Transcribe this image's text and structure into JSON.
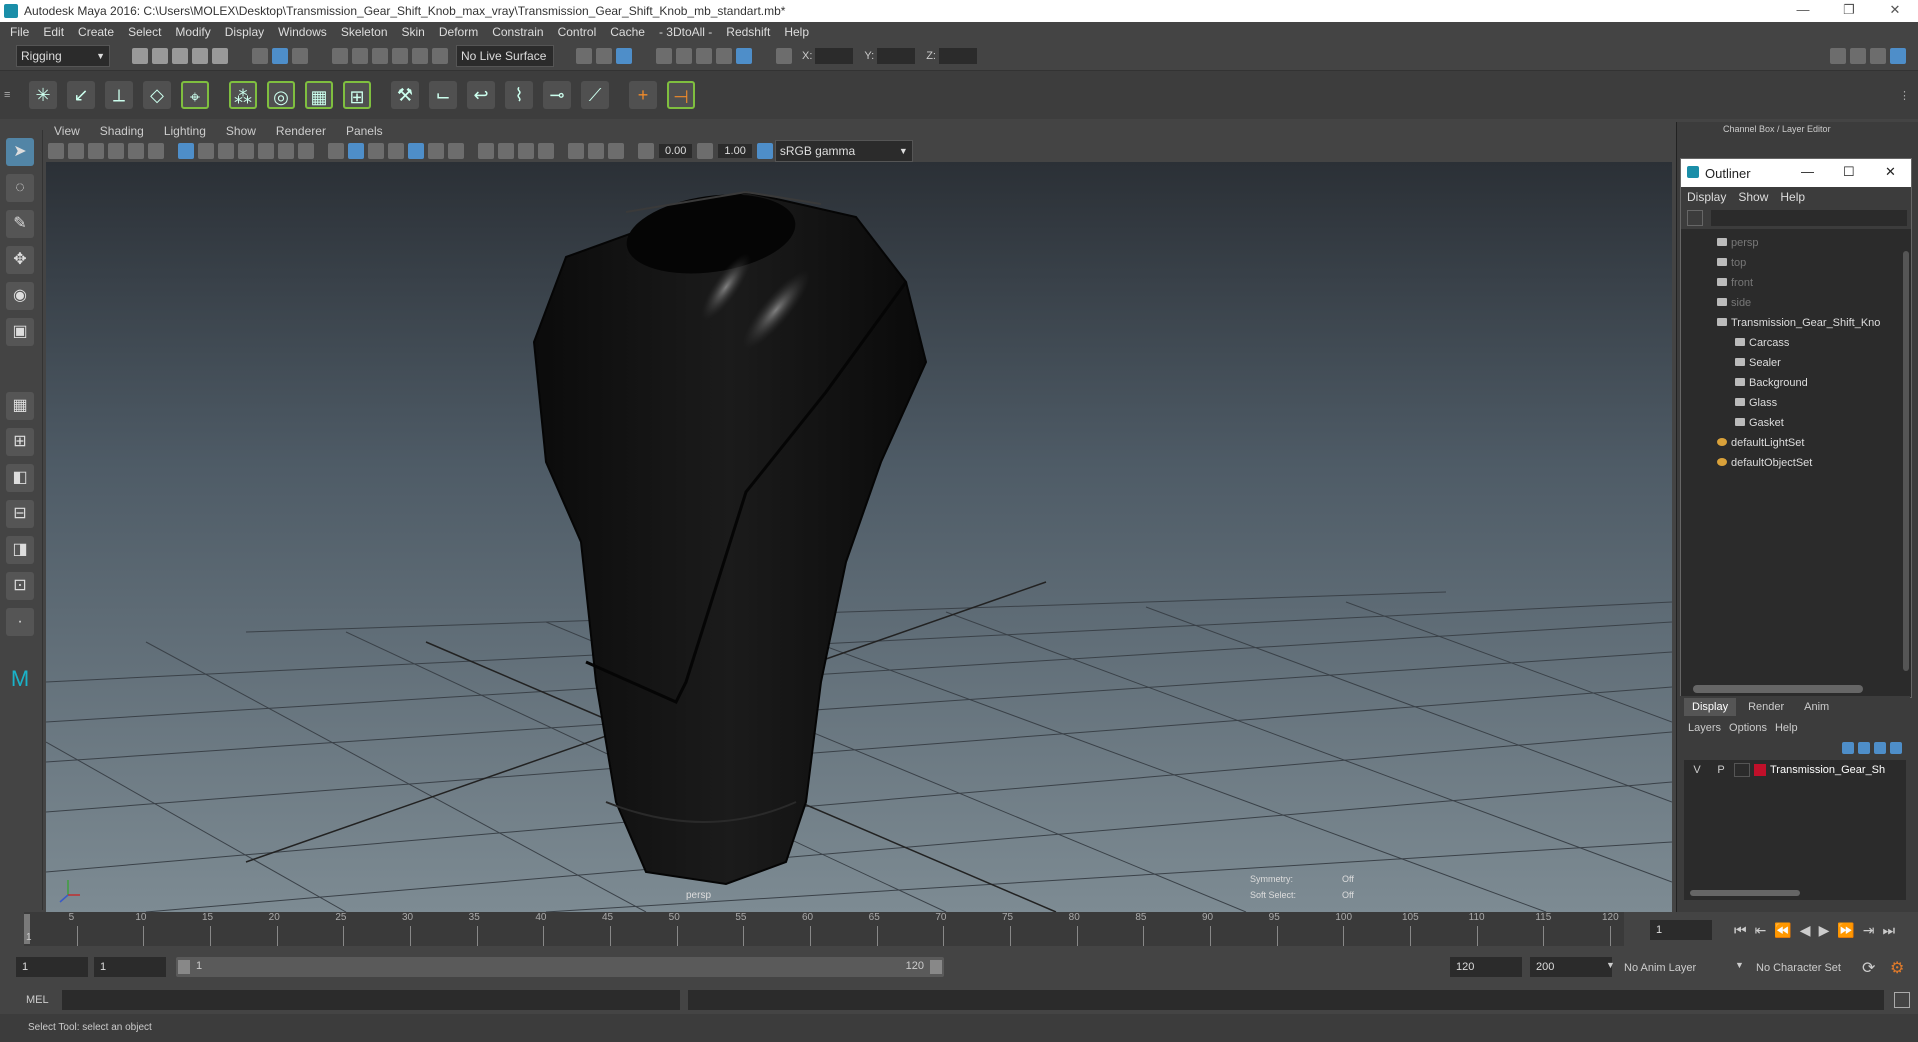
{
  "window": {
    "title": "Autodesk Maya 2016: C:\\Users\\MOLEX\\Desktop\\Transmission_Gear_Shift_Knob_max_vray\\Transmission_Gear_Shift_Knob_mb_standart.mb*"
  },
  "menubar": [
    "File",
    "Edit",
    "Create",
    "Select",
    "Modify",
    "Display",
    "Windows",
    "Skeleton",
    "Skin",
    "Deform",
    "Constrain",
    "Control",
    "Cache",
    "- 3DtoAll -",
    "Redshift",
    "Help"
  ],
  "statusline": {
    "mode": "Rigging",
    "live_surface": "No Live Surface",
    "x_label": "X:",
    "y_label": "Y:",
    "z_label": "Z:"
  },
  "panel_menu": [
    "View",
    "Shading",
    "Lighting",
    "Show",
    "Renderer",
    "Panels"
  ],
  "panel_tools": {
    "exposure": "0.00",
    "gamma": "1.00",
    "color_space": "sRGB gamma"
  },
  "viewport": {
    "camera": "persp",
    "symmetry_label": "Symmetry:",
    "symmetry_value": "Off",
    "soft_select_label": "Soft Select:",
    "soft_select_value": "Off"
  },
  "channel_box_title": "Channel Box / Layer Editor",
  "outliner": {
    "title": "Outliner",
    "menu": [
      "Display",
      "Show",
      "Help"
    ],
    "items": [
      {
        "label": "persp",
        "dim": true,
        "indent": 2
      },
      {
        "label": "top",
        "dim": true,
        "indent": 2
      },
      {
        "label": "front",
        "dim": true,
        "indent": 2
      },
      {
        "label": "side",
        "dim": true,
        "indent": 2
      },
      {
        "label": "Transmission_Gear_Shift_Kno",
        "dim": false,
        "indent": 2
      },
      {
        "label": "Carcass",
        "dim": false,
        "indent": 3
      },
      {
        "label": "Sealer",
        "dim": false,
        "indent": 3
      },
      {
        "label": "Background",
        "dim": false,
        "indent": 3
      },
      {
        "label": "Glass",
        "dim": false,
        "indent": 3
      },
      {
        "label": "Gasket",
        "dim": false,
        "indent": 3
      },
      {
        "label": "defaultLightSet",
        "dim": false,
        "indent": 2
      },
      {
        "label": "defaultObjectSet",
        "dim": false,
        "indent": 2
      }
    ]
  },
  "layer_editor": {
    "tabs": [
      "Display",
      "Render",
      "Anim"
    ],
    "menu": [
      "Layers",
      "Options",
      "Help"
    ],
    "layer": {
      "v": "V",
      "p": "P",
      "name": "Transmission_Gear_Sh",
      "color": "#c0102a"
    }
  },
  "timeline": {
    "ticks": [
      "5",
      "10",
      "15",
      "20",
      "25",
      "30",
      "35",
      "40",
      "45",
      "50",
      "55",
      "60",
      "65",
      "70",
      "75",
      "80",
      "85",
      "90",
      "95",
      "100",
      "105",
      "110",
      "115",
      "120"
    ],
    "start_mark": "1",
    "current_frame": "1"
  },
  "range": {
    "start": "1",
    "inner_start": "1",
    "slider_start": "1",
    "slider_end": "120",
    "end": "120",
    "max_end": "200",
    "anim_layer": "No Anim Layer",
    "char_set": "No Character Set"
  },
  "cmdline": {
    "label": "MEL"
  },
  "helpline": {
    "text": "Select Tool: select an object"
  }
}
